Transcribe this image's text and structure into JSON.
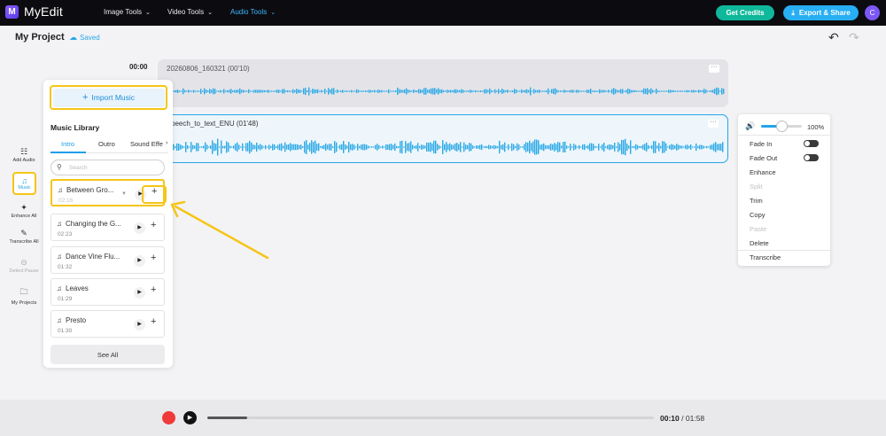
{
  "app": {
    "name": "MyEdit"
  },
  "nav": [
    {
      "label": "Image Tools",
      "active": false
    },
    {
      "label": "Video Tools",
      "active": false
    },
    {
      "label": "Audio Tools",
      "active": true
    }
  ],
  "header": {
    "credits_label": "Get Credits",
    "export_label": "Export & Share",
    "avatar_initial": "C"
  },
  "project": {
    "title": "My Project",
    "status": "Saved"
  },
  "sidebar": {
    "items": [
      {
        "label": "Add Audio",
        "icon": "add-audio-icon"
      },
      {
        "label": "Music",
        "icon": "music-icon"
      },
      {
        "label": "Enhance All",
        "icon": "magic-wand-icon"
      },
      {
        "label": "Transcribe All",
        "icon": "transcribe-icon"
      },
      {
        "label": "Detect Pause",
        "icon": "detect-pause-icon"
      },
      {
        "label": "My Projects",
        "icon": "folder-icon"
      }
    ]
  },
  "timeline": {
    "start_time": "00:00",
    "tracks": [
      {
        "title": "20260806_160321 (00'10)",
        "selected": false
      },
      {
        "title": "peech_to_text_ENU (01'48)",
        "selected": true
      }
    ]
  },
  "library": {
    "import_label": "Import Music",
    "title": "Music Library",
    "tabs": [
      "Intro",
      "Outro",
      "Sound Effe"
    ],
    "active_tab": 0,
    "search_placeholder": "Search",
    "songs": [
      {
        "name": "Between Gro...",
        "duration": "02:16"
      },
      {
        "name": "Changing the G...",
        "duration": "02:23"
      },
      {
        "name": "Dance Vine Flu...",
        "duration": "01:32"
      },
      {
        "name": "Leaves",
        "duration": "01:29"
      },
      {
        "name": "Presto",
        "duration": "01:30"
      }
    ],
    "see_all_label": "See All"
  },
  "context_menu": {
    "volume_percent": 100,
    "volume_label": "100%",
    "items": [
      {
        "label": "Fade In",
        "enabled": true
      },
      {
        "label": "Fade Out",
        "enabled": true
      },
      {
        "label": "Enhance",
        "enabled": true
      },
      {
        "label": "Split",
        "enabled": false
      },
      {
        "label": "Trim",
        "enabled": true
      },
      {
        "label": "Copy",
        "enabled": true
      },
      {
        "label": "Paste",
        "enabled": false
      },
      {
        "label": "Delete",
        "enabled": true
      },
      {
        "label": "Transcribe",
        "enabled": true
      }
    ]
  },
  "player": {
    "current_time": "00:10",
    "separator": "/",
    "total_time": "01:58",
    "progress": 0.09
  },
  "colors": {
    "accent": "#26a4ea",
    "highlight": "#f5c518",
    "credits": "#0fb89b",
    "record": "#f03a3a"
  }
}
